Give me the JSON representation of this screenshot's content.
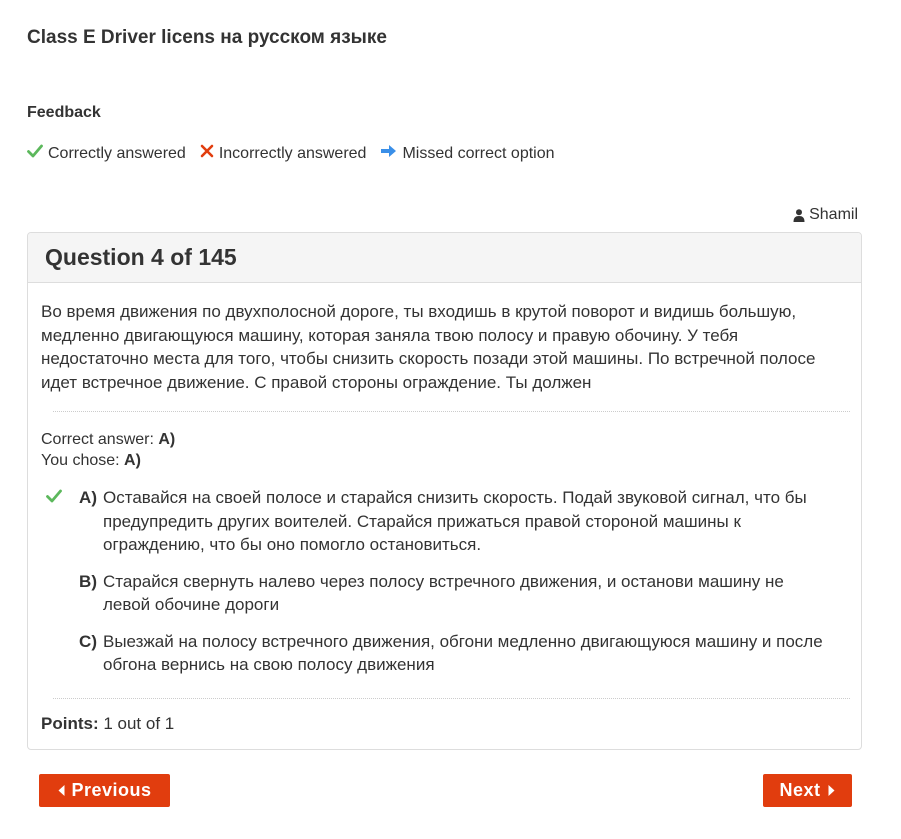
{
  "page": {
    "title": "Class E Driver licens на русском языке"
  },
  "feedback": {
    "heading": "Feedback",
    "legend": [
      {
        "icon": "check-icon",
        "label": "Correctly answered",
        "color": "#5cb85c"
      },
      {
        "icon": "cross-icon",
        "label": "Incorrectly answered",
        "color": "#e13d0e"
      },
      {
        "icon": "arrow-right-icon",
        "label": "Missed correct option",
        "color": "#3a8fe8"
      }
    ]
  },
  "user": {
    "icon": "user-icon",
    "name": "Shamil"
  },
  "question": {
    "title": "Question 4 of 145",
    "text": "Во время движения по двухполосной дороге, ты входишь в крутой поворот и видишь большую, медленно двигающуюся машину, которая заняла твою полосу и правую обочину. У тебя недостаточно места для того, чтобы снизить скорость позади этой машины. По встречной полосе идет встречное движение. С правой стороны ограждение. Ты должен",
    "correct_answer_label": "Correct answer:",
    "correct_answer_value": "A)",
    "you_chose_label": "You chose:",
    "you_chose_value": "A)",
    "options": [
      {
        "letter": "A)",
        "text": "Оставайся на своей полосе и старайся снизить скорость. Подай звуковой сигнал, что бы предупредить других воителей. Старайся прижаться правой стороной машины к ограждению, что бы оно помогло остановиться.",
        "mark": "check-icon"
      },
      {
        "letter": "B)",
        "text": "Старайся свернуть налево через полосу встречного движения, и останови машину не левой обочине дороги",
        "mark": ""
      },
      {
        "letter": "C)",
        "text": "Выезжай на полосу встречного движения, обгони медленно двигающуюся машину и после обгона вернись на свою полосу движения",
        "mark": ""
      }
    ],
    "points_label": "Points:",
    "points_value": "1 out of 1"
  },
  "navigation": {
    "previous_label": "Previous",
    "next_label": "Next",
    "button_color": "#e13d0e"
  }
}
